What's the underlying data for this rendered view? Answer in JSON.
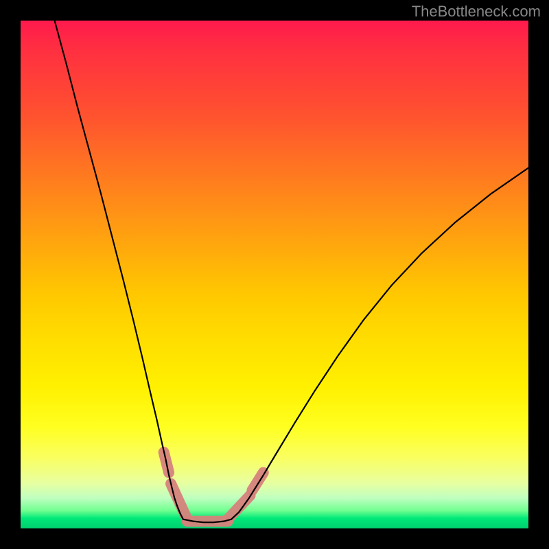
{
  "watermark": "TheBottleneck.com",
  "chart_data": {
    "type": "line",
    "title": "",
    "xlabel": "",
    "ylabel": "",
    "xlim": [
      0,
      1
    ],
    "ylim": [
      0,
      1
    ],
    "series": [
      {
        "name": "left-branch",
        "x": [
          0.067,
          0.09,
          0.112,
          0.135,
          0.158,
          0.18,
          0.202,
          0.222,
          0.24,
          0.255,
          0.268,
          0.278,
          0.286,
          0.292,
          0.298,
          0.303,
          0.308,
          0.314,
          0.32
        ],
        "y": [
          1.0,
          0.915,
          0.83,
          0.745,
          0.66,
          0.575,
          0.49,
          0.41,
          0.335,
          0.27,
          0.215,
          0.17,
          0.135,
          0.105,
          0.08,
          0.06,
          0.045,
          0.03,
          0.018
        ]
      },
      {
        "name": "flat-bottom",
        "x": [
          0.32,
          0.34,
          0.36,
          0.38,
          0.4,
          0.415
        ],
        "y": [
          0.018,
          0.014,
          0.012,
          0.012,
          0.014,
          0.018
        ]
      },
      {
        "name": "right-branch",
        "x": [
          0.415,
          0.43,
          0.45,
          0.475,
          0.505,
          0.54,
          0.58,
          0.625,
          0.675,
          0.73,
          0.79,
          0.855,
          0.925,
          1.0
        ],
        "y": [
          0.018,
          0.032,
          0.06,
          0.1,
          0.15,
          0.208,
          0.272,
          0.34,
          0.41,
          0.478,
          0.542,
          0.602,
          0.658,
          0.71
        ]
      }
    ],
    "highlight_segments": [
      {
        "x": [
          0.282,
          0.292
        ],
        "y": [
          0.15,
          0.11
        ]
      },
      {
        "x": [
          0.296,
          0.328
        ],
        "y": [
          0.088,
          0.018
        ]
      },
      {
        "x": [
          0.328,
          0.408
        ],
        "y": [
          0.014,
          0.014
        ]
      },
      {
        "x": [
          0.408,
          0.452
        ],
        "y": [
          0.018,
          0.065
        ]
      },
      {
        "x": [
          0.456,
          0.478
        ],
        "y": [
          0.075,
          0.11
        ]
      }
    ],
    "colors": {
      "background_top": "#ff1a4d",
      "background_bottom": "#00d070",
      "curve": "#000000",
      "highlight": "#d6827c",
      "frame": "#000000",
      "watermark": "#888888"
    }
  }
}
